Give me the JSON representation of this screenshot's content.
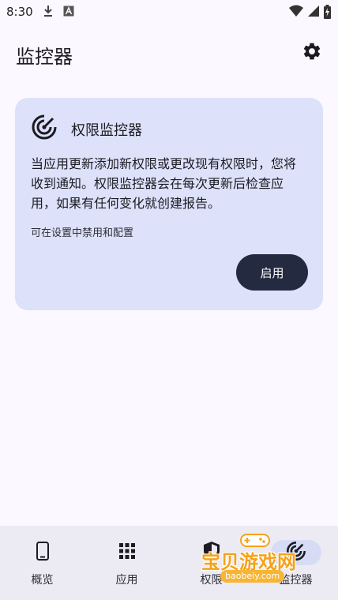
{
  "status_bar": {
    "time": "8:30",
    "icons": [
      "download-icon",
      "font-a-icon",
      "wifi-icon",
      "cellular-icon",
      "battery-charging-icon"
    ]
  },
  "app_bar": {
    "title": "监控器",
    "settings_icon": "gear-icon"
  },
  "card": {
    "icon": "radar-icon",
    "title": "权限监控器",
    "description": "当应用更新添加新权限或更改现有权限时，您将收到通知。权限监控器会在每次更新后检查应用，如果有任何变化就创建报告。",
    "note": "可在设置中禁用和配置",
    "enable_label": "启用"
  },
  "bottom_nav": {
    "items": [
      {
        "label": "概览",
        "icon": "phone-icon",
        "active": false
      },
      {
        "label": "应用",
        "icon": "apps-grid-icon",
        "active": false
      },
      {
        "label": "权限",
        "icon": "shield-icon",
        "active": false
      },
      {
        "label": "监控器",
        "icon": "radar-icon",
        "active": true
      }
    ]
  },
  "watermark": {
    "text": "宝贝游戏网",
    "url": "baobeiy.com"
  },
  "colors": {
    "background": "#fcf8ff",
    "card": "#dde1fa",
    "button": "#242a40",
    "nav": "#ecebf3",
    "nav_active": "#d7dcf6"
  }
}
